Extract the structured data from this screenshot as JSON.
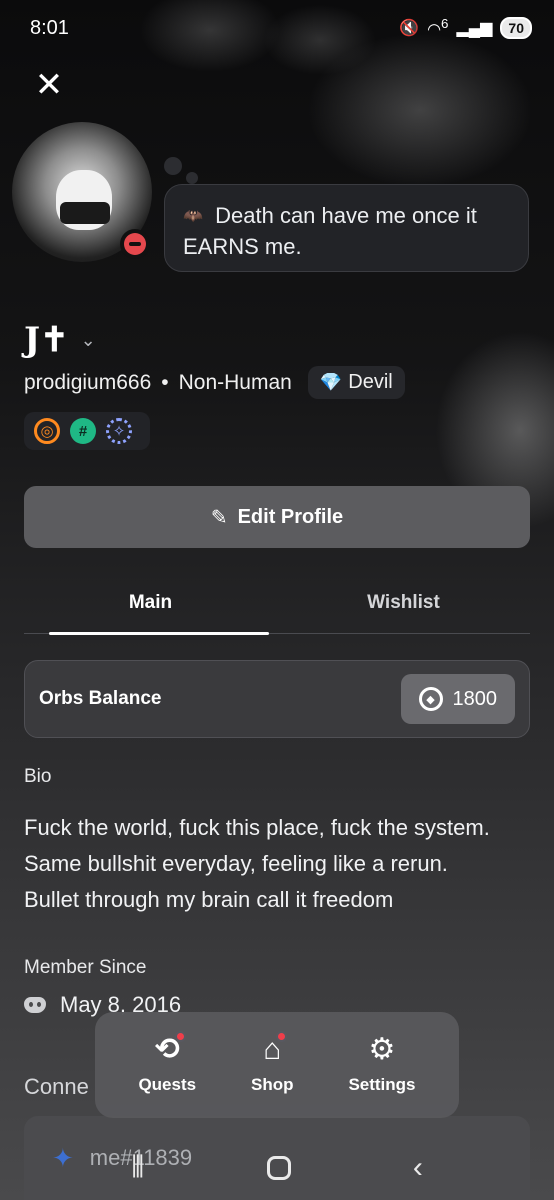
{
  "status_bar": {
    "time": "8:01",
    "signal_text": "6",
    "battery": "70"
  },
  "profile": {
    "custom_status": "Death can have me once it EARNS me.",
    "display_name": "J✝",
    "username": "prodigium666",
    "separator": "•",
    "pronouns": "Non-Human",
    "tag_label": "Devil",
    "badges": [
      "hypesquad-icon",
      "hashtag-icon",
      "laurel-icon"
    ]
  },
  "actions": {
    "edit_profile": "Edit Profile"
  },
  "tabs": [
    {
      "label": "Main",
      "active": true
    },
    {
      "label": "Wishlist",
      "active": false
    }
  ],
  "orbs": {
    "label": "Orbs Balance",
    "value": "1800"
  },
  "bio": {
    "heading": "Bio",
    "lines": [
      "Fuck the world, fuck this place, fuck the system.",
      "Same bullshit everyday, feeling like a rerun.",
      "Bullet through my brain call it freedom"
    ]
  },
  "member_since": {
    "heading": "Member Since",
    "date": "May 8, 2016"
  },
  "connections": {
    "heading": "Conne",
    "account": "me#11839"
  },
  "dock": [
    {
      "label": "Quests",
      "icon": "quests-icon",
      "notification": true
    },
    {
      "label": "Shop",
      "icon": "shop-icon",
      "notification": true
    },
    {
      "label": "Settings",
      "icon": "gear-icon",
      "notification": false
    }
  ],
  "colors": {
    "dnd": "#e5484d",
    "notification_dot": "#ef3e4a",
    "devil_gem": "#ff5cc4"
  }
}
